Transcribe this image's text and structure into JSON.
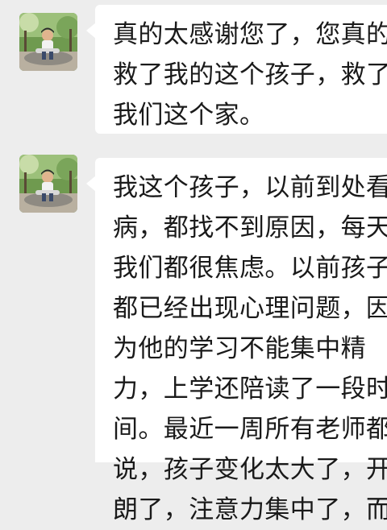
{
  "messages": [
    {
      "lines": [
        "真的太感谢您了，您真的",
        "救了我的这个孩子，救了",
        "我们这个家。"
      ]
    },
    {
      "lines": [
        "我这个孩子，以前到处看",
        "病，都找不到原因，每天",
        "我们都很焦虑。以前孩子",
        "都已经出现心理问题，因",
        "为他的学习不能集中精",
        "力，上学还陪读了一段时",
        "间。最近一周所有老师都",
        "说，孩子变化太大了，开",
        "朗了，注意力集中了，而"
      ]
    }
  ],
  "colors": {
    "chat_background": "#ededed",
    "bubble_background": "#ffffff",
    "text": "#1a1a1a"
  }
}
